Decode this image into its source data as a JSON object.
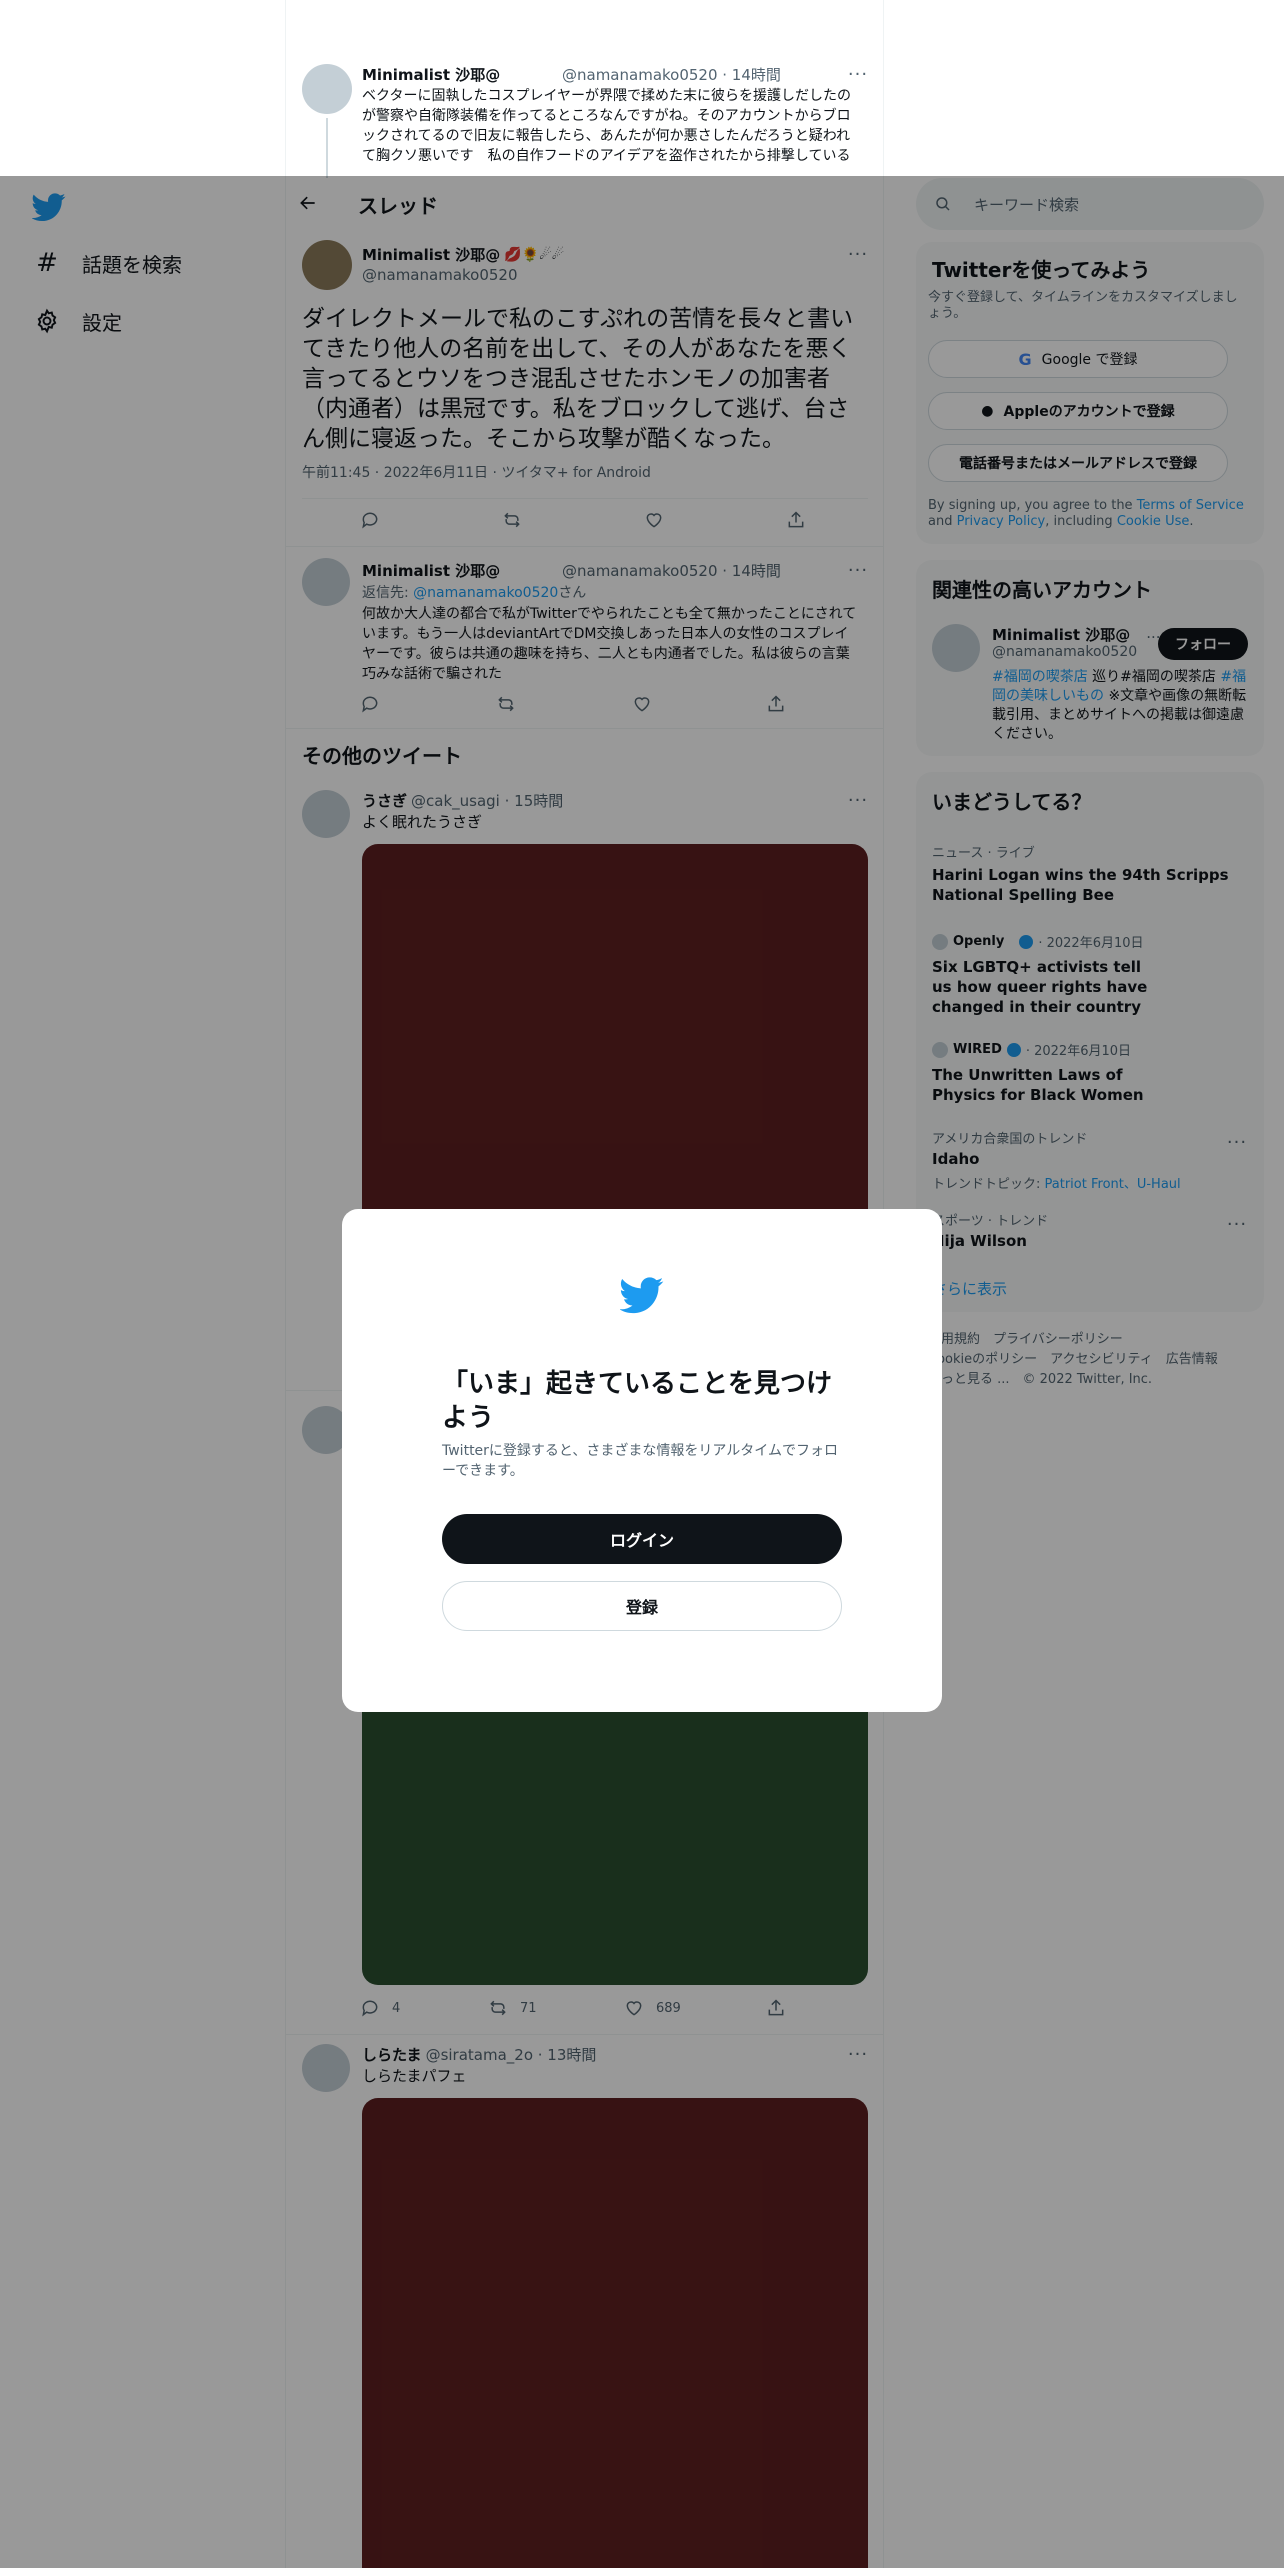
{
  "nav": {
    "explore_label": "話題を検索",
    "settings_label": "設定"
  },
  "header": {
    "title": "スレッド",
    "search_placeholder": "キーワード検索"
  },
  "top_tweet": {
    "name": "Minimalist 沙耶@",
    "handle_time": "@namanamako0520 · 14時間",
    "text": "ベクターに固執したコスプレイヤーが界隈で揉めた末に彼らを援護しだしたのが警察や自衛隊装備を作ってるところなんですがね。そのアカウントからブロックされてるので旧友に報告したら、あんたが何か悪さしたんだろうと疑われて胸クソ悪いです　私の自作フードのアイデアを盗作されたから排撃している"
  },
  "main_tweet": {
    "name": "Minimalist 沙耶@",
    "emojis": "💋🌻☄☄",
    "handle": "@namanamako0520",
    "text": "ダイレクトメールで私のこすぷれの苦情を長々と書いてきたり他人の名前を出して、その人があなたを悪く言ってるとウソをつき混乱させたホンモノの加害者（内通者）は黒冠です。私をブロックして逃げ、台さん側に寝返った。そこから攻撃が酷くなった。",
    "meta": "午前11:45 · 2022年6月11日 · ツイタマ+ for Android"
  },
  "reply_tweet": {
    "name": "Minimalist 沙耶@",
    "handle_time": "@namanamako0520 · 14時間",
    "reply_prefix": "返信先: ",
    "reply_to": "@namanamako0520",
    "reply_suffix": "さん",
    "text": "何故か大人達の都合で私がTwitterでやられたことも全て無かったことにされています。もう一人はdeviantArtでDM交換しあった日本人の女性のコスプレイヤーです。彼らは共通の趣味を持ち、二人とも内通者でした。私は彼らの言葉巧みな話術で騙された"
  },
  "other_tweets_heading": "その他のツイート",
  "other_tweets": [
    {
      "name": "うさぎ",
      "handle_time": "@cak_usagi · 15時間",
      "text": "よく眠れたうさぎ",
      "image_color": "#5d1f20"
    },
    {
      "image_color": "#2a4f2f",
      "replies": "4",
      "retweets": "71",
      "likes": "689"
    },
    {
      "name": "しらたま",
      "handle_time": "@siratama_2o · 13時間",
      "text": "しらたまパフェ",
      "image_color": "#5d1f20"
    }
  ],
  "signup_box": {
    "title": "Twitterを使ってみよう",
    "subtitle": "今すぐ登録して、タイムラインをカスタマイズしましょう。",
    "google": "Google で登録",
    "apple": "Appleのアカウントで登録",
    "phone": "電話番号またはメールアドレスで登録",
    "terms_1": "By signing up, you agree to the ",
    "terms_link1": "Terms of Service",
    "terms_2": " and ",
    "terms_link2": "Privacy Policy",
    "terms_3": ", including ",
    "terms_link3": "Cookie Use",
    "terms_4": "."
  },
  "related": {
    "title": "関連性の高いアカウント",
    "name": "Minimalist 沙耶@",
    "ellipsis": "...",
    "handle": "@namanamako0520",
    "follow": "フォロー",
    "bio_tag1": "#福岡の喫茶店",
    "bio_mid": " 巡り#福岡の喫茶店 ",
    "bio_tag2": "#福岡の美味しいもの",
    "bio_rest": " ※文章や画像の無断転載引用、まとめサイトへの掲載は御遠慮ください。"
  },
  "trends": {
    "title": "いまどうしてる？",
    "items": [
      {
        "meta": "ニュース · ライブ",
        "title": "Harini Logan wins the 94th Scripps National Spelling Bee"
      },
      {
        "source": "Openly",
        "date": "· 2022年6月10日",
        "title": "Six LGBTQ+ activists tell us how queer rights have changed in their country"
      },
      {
        "source": "WIRED",
        "date": "· 2022年6月10日",
        "title": "The Unwritten Laws of Physics for Black Women"
      },
      {
        "meta": "アメリカ合衆国のトレンド",
        "title": "Idaho",
        "sub_prefix": "トレンドトピック: ",
        "sub_links": "Patriot Front、U-Haul"
      },
      {
        "meta": "スポーツ · トレンド",
        "title": "Nija Wilson"
      }
    ],
    "show_more": "さらに表示"
  },
  "footer": {
    "line1": "利用規約　プライバシーポリシー",
    "line2": "Cookieのポリシー　アクセシビリティ　広告情報",
    "line3": "もっと見る ...　© 2022 Twitter, Inc."
  },
  "modal": {
    "title": "「いま」起きていることを見つけよう",
    "subtitle": "Twitterに登録すると、さまざまな情報をリアルタイムでフォローできます。",
    "login": "ログイン",
    "signup": "登録"
  },
  "colors": {
    "brand": "#1d9bf0",
    "overlay": "rgba(0,0,0,0.4)"
  }
}
